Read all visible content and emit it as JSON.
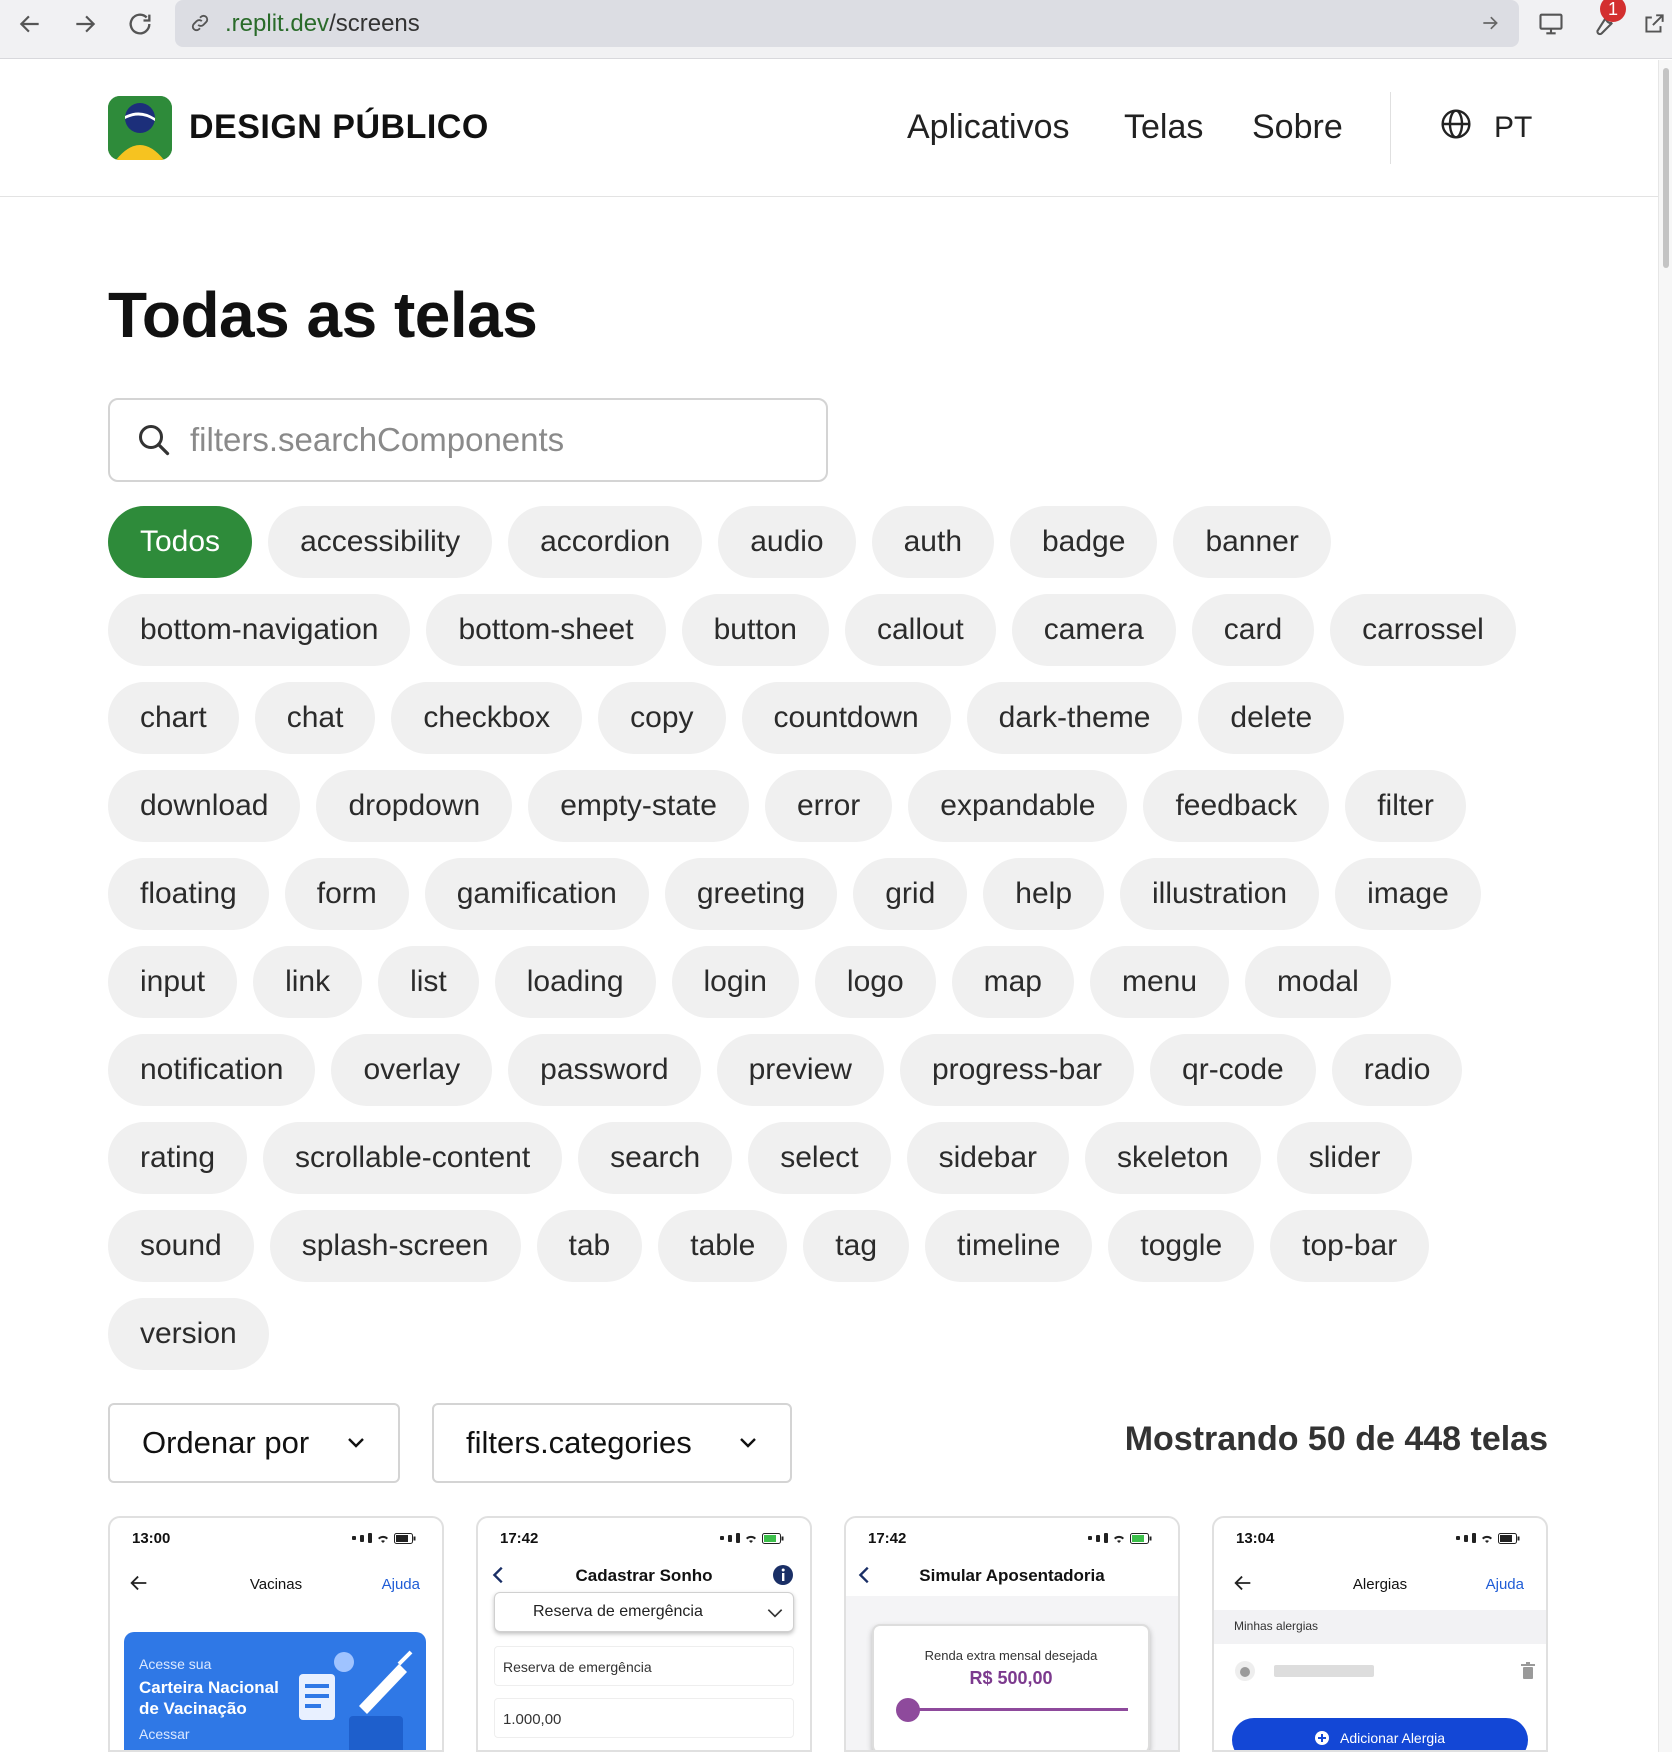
{
  "browser": {
    "url_prefix": ".replit.dev",
    "url_path": "/screens",
    "extension_badge": "1"
  },
  "header": {
    "brand": "DESIGN PÚBLICO",
    "nav": [
      "Aplicativos",
      "Telas",
      "Sobre"
    ],
    "language": "PT"
  },
  "main": {
    "title": "Todas as telas",
    "search_placeholder": "filters.searchComponents",
    "chips": [
      "Todos",
      "accessibility",
      "accordion",
      "audio",
      "auth",
      "badge",
      "banner",
      "bottom-navigation",
      "bottom-sheet",
      "button",
      "callout",
      "camera",
      "card",
      "carrossel",
      "chart",
      "chat",
      "checkbox",
      "copy",
      "countdown",
      "dark-theme",
      "delete",
      "download",
      "dropdown",
      "empty-state",
      "error",
      "expandable",
      "feedback",
      "filter",
      "floating",
      "form",
      "gamification",
      "greeting",
      "grid",
      "help",
      "illustration",
      "image",
      "input",
      "link",
      "list",
      "loading",
      "login",
      "logo",
      "map",
      "menu",
      "modal",
      "notification",
      "overlay",
      "password",
      "preview",
      "progress-bar",
      "qr-code",
      "radio",
      "rating",
      "scrollable-content",
      "search",
      "select",
      "sidebar",
      "skeleton",
      "slider",
      "sound",
      "splash-screen",
      "tab",
      "table",
      "tag",
      "timeline",
      "toggle",
      "top-bar",
      "version"
    ],
    "active_chip": "Todos",
    "sort_label": "Ordenar por",
    "categories_label": "filters.categories",
    "count_text": "Mostrando 50 de 448 telas"
  },
  "cards": [
    {
      "time": "13:00",
      "title": "Vacinas",
      "help": "Ajuda",
      "banner_small": "Acesse sua",
      "banner_title_1": "Carteira Nacional",
      "banner_title_2": "de Vacinação",
      "banner_link": "Acessar"
    },
    {
      "time": "17:42",
      "title": "Cadastrar Sonho",
      "dropdown_value": "Reserva de emergência",
      "field_1": "Reserva de emergência",
      "field_2": "1.000,00"
    },
    {
      "time": "17:42",
      "title": "Simular Aposentadoria",
      "label": "Renda extra mensal desejada",
      "value": "R$ 500,00",
      "slider_fraction": 0.02
    },
    {
      "time": "13:04",
      "title": "Alergias",
      "help": "Ajuda",
      "section": "Minhas alergias",
      "button": "Adicionar Alergia"
    }
  ],
  "colors": {
    "accent_green": "#2e8b3a",
    "chip_bg": "#f0f0f0",
    "link_blue": "#1f5cd6",
    "slider_purple": "#8e4a9c"
  }
}
